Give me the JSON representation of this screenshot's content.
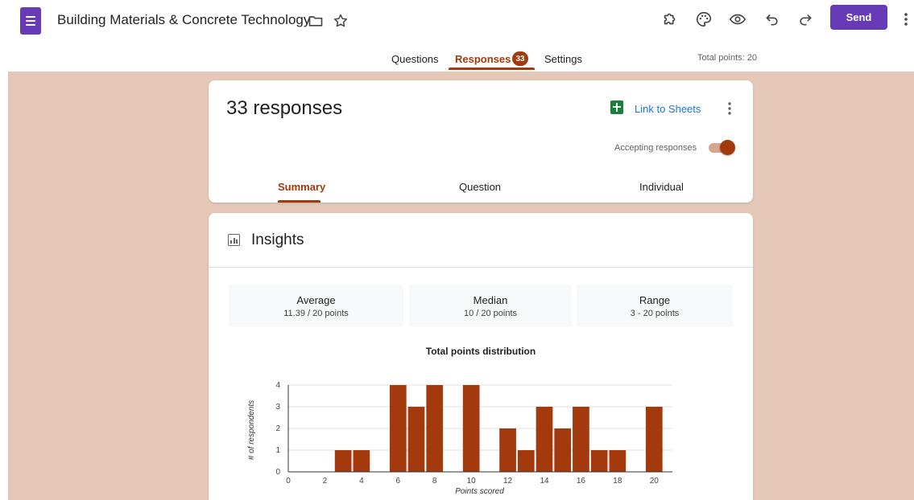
{
  "header": {
    "doc_title": "Building Materials & Concrete Technology",
    "send_label": "Send",
    "icons": [
      "forms-icon",
      "folder-icon",
      "star-icon",
      "addons-icon",
      "palette-icon",
      "preview-icon",
      "undo-icon",
      "redo-icon",
      "more-vert-icon"
    ]
  },
  "tabs": {
    "questions": "Questions",
    "responses": "Responses",
    "responses_badge": "33",
    "settings": "Settings",
    "total_points": "Total points: 20"
  },
  "summary_card": {
    "count_text": "33 responses",
    "link_sheets": "Link to Sheets",
    "accepting_label": "Accepting responses",
    "accepting_on": true,
    "subtabs": [
      "Summary",
      "Question",
      "Individual"
    ],
    "active_subtab": "Summary"
  },
  "insights": {
    "title": "Insights",
    "stats": [
      {
        "label": "Average",
        "value": "11.39 / 20 points"
      },
      {
        "label": "Median",
        "value": "10 / 20 points"
      },
      {
        "label": "Range",
        "value": "3 - 20 points"
      }
    ]
  },
  "colors": {
    "brand_purple": "#673ab7",
    "accent": "#a33a0d",
    "canvas_bg": "#e5c7b8",
    "link_blue": "#1a73e8",
    "sheets_green": "#188038"
  },
  "chart_data": {
    "type": "bar",
    "title": "Total points distribution",
    "xlabel": "Points scored",
    "ylabel": "# of respondents",
    "x": [
      3,
      4,
      6,
      7,
      8,
      10,
      12,
      13,
      14,
      15,
      16,
      17,
      18,
      20
    ],
    "values": [
      1,
      1,
      4,
      3,
      4,
      4,
      2,
      1,
      3,
      2,
      3,
      1,
      1,
      3
    ],
    "xlim": [
      0,
      21
    ],
    "ylim": [
      0,
      4
    ],
    "x_ticks": [
      "0",
      "2",
      "4",
      "6",
      "8",
      "10",
      "12",
      "14",
      "16",
      "18",
      "20"
    ],
    "y_ticks": [
      "0",
      "1",
      "2",
      "3",
      "4"
    ],
    "grid": true,
    "bar_color": "#a33a0d"
  }
}
